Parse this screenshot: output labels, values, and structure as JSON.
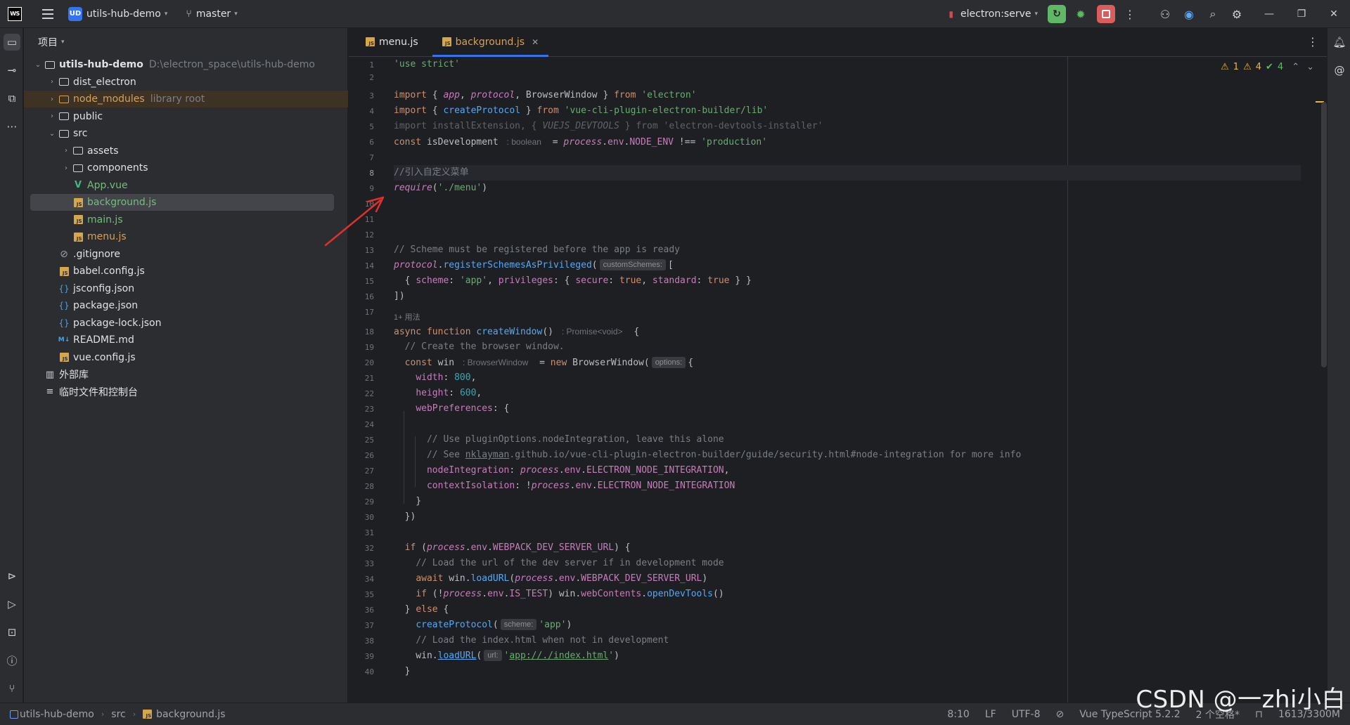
{
  "titlebar": {
    "app_logo": "WS",
    "project_badge": "UD",
    "project_name": "utils-hub-demo",
    "branch": "master",
    "run_config": "electron:serve"
  },
  "project_panel": {
    "header": "项目",
    "tree": [
      {
        "label": "utils-hub-demo",
        "hint": "D:\\electron_space\\utils-hub-demo",
        "type": "folder",
        "depth": 0,
        "expanded": true
      },
      {
        "label": "dist_electron",
        "type": "folder",
        "depth": 1
      },
      {
        "label": "node_modules",
        "hint": "library root",
        "type": "folder-excluded",
        "depth": 1
      },
      {
        "label": "public",
        "type": "folder",
        "depth": 1
      },
      {
        "label": "src",
        "type": "folder",
        "depth": 1,
        "expanded": true
      },
      {
        "label": "assets",
        "type": "folder",
        "depth": 2
      },
      {
        "label": "components",
        "type": "folder",
        "depth": 2
      },
      {
        "label": "App.vue",
        "type": "vue",
        "depth": 2
      },
      {
        "label": "background.js",
        "type": "js",
        "depth": 2,
        "selected": true
      },
      {
        "label": "main.js",
        "type": "js",
        "depth": 2
      },
      {
        "label": "menu.js",
        "type": "js",
        "depth": 2
      },
      {
        "label": ".gitignore",
        "type": "gitignore",
        "depth": 1
      },
      {
        "label": "babel.config.js",
        "type": "js",
        "depth": 1
      },
      {
        "label": "jsconfig.json",
        "type": "json",
        "depth": 1
      },
      {
        "label": "package.json",
        "type": "json",
        "depth": 1
      },
      {
        "label": "package-lock.json",
        "type": "json",
        "depth": 1
      },
      {
        "label": "README.md",
        "type": "md",
        "depth": 1
      },
      {
        "label": "vue.config.js",
        "type": "js",
        "depth": 1
      },
      {
        "label": "外部库",
        "type": "library",
        "depth": 0
      },
      {
        "label": "临时文件和控制台",
        "type": "scratch",
        "depth": 0
      }
    ]
  },
  "editor": {
    "tabs": [
      {
        "label": "menu.js",
        "active": false
      },
      {
        "label": "background.js",
        "active": true
      }
    ],
    "inspections": {
      "warnings": "1",
      "weak_warnings": "4",
      "ok": "4"
    },
    "line_numbers": [
      "1",
      "2",
      "3",
      "4",
      "5",
      "6",
      "7",
      "8",
      "9",
      "10",
      "11",
      "12",
      "13",
      "14",
      "15",
      "16",
      "17",
      "18",
      "19",
      "20",
      "21",
      "22",
      "23",
      "24",
      "25",
      "26",
      "27",
      "28",
      "29",
      "30",
      "31",
      "32",
      "33",
      "34",
      "35",
      "36",
      "37",
      "38",
      "39",
      "40"
    ],
    "usage_hint": "1+ 用法",
    "inlay_hints": {
      "boolean": "boolean",
      "custom_schemes": "customSchemes:",
      "promise_void": "Promise<void>",
      "browser_window": "BrowserWindow",
      "options": "options:",
      "scheme": "scheme:",
      "url": "url:"
    }
  },
  "statusbar": {
    "breadcrumb": [
      "utils-hub-demo",
      "src",
      "background.js"
    ],
    "position": "8:10",
    "line_sep": "LF",
    "encoding": "UTF-8",
    "language": "Vue TypeScript 5.2.2",
    "indent": "2 个空格*",
    "memory": "1613/3300M"
  },
  "watermark": "CSDN @一zhi小白"
}
